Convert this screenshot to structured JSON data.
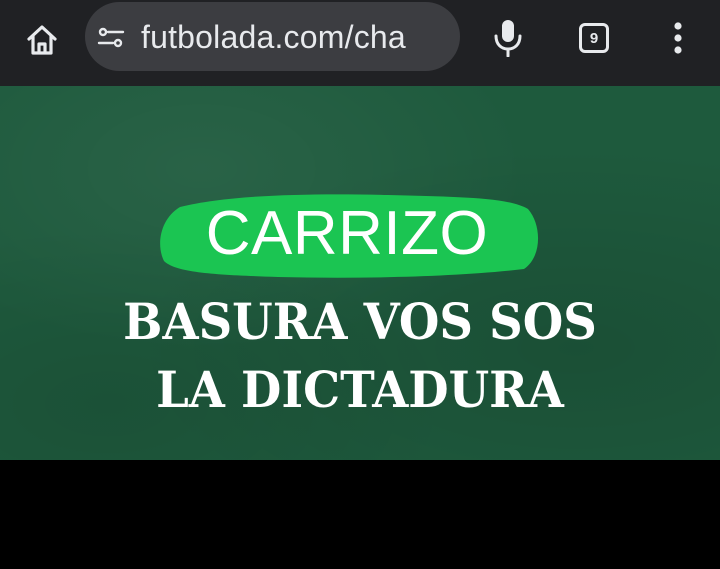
{
  "browser": {
    "url_text": "futbolada.com/cha",
    "tab_count": "9",
    "icons": {
      "home": "home-icon",
      "site_info": "tune-icon",
      "mic": "microphone-icon",
      "tabs": "tab-switcher-icon",
      "menu": "more-vert-icon"
    },
    "colors": {
      "toolbar_bg": "#202124",
      "omnibox_bg": "#3c3d41",
      "icon": "#e8eaed"
    }
  },
  "banner": {
    "name": "CARRIZO",
    "line1": "BASURA VOS SOS",
    "line2": "LA DICTADURA",
    "colors": {
      "background": "#1e5a3d",
      "highlight": "#1bc552",
      "text": "#ffffff"
    }
  }
}
